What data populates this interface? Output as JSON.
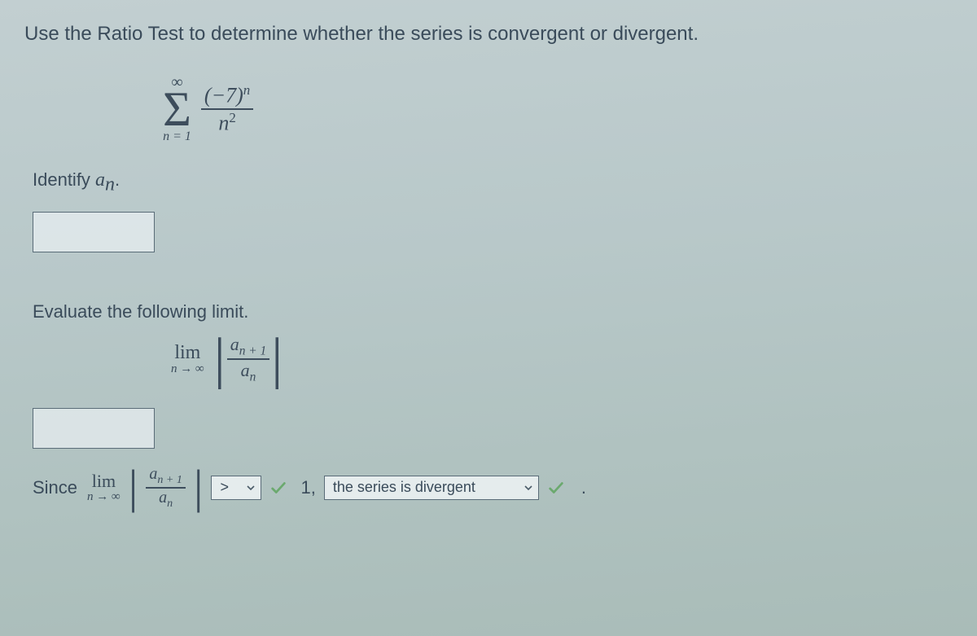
{
  "prompt": "Use the Ratio Test to determine whether the series is convergent or divergent.",
  "series": {
    "upper": "∞",
    "lower": "n = 1",
    "numerator_base": "(−7)",
    "numerator_exp": "n",
    "denominator_base": "n",
    "denominator_exp": "2"
  },
  "identify": {
    "label_pre": "Identify ",
    "var": "a",
    "sub": "n",
    "label_post": "."
  },
  "input1": "",
  "evaluate_label": "Evaluate the following limit.",
  "limit": {
    "lim": "lim",
    "below": "n → ∞",
    "num_base": "a",
    "num_sub": "n + 1",
    "den_base": "a",
    "den_sub": "n"
  },
  "input2": "",
  "conclusion": {
    "since": "Since",
    "lim": "lim",
    "below": "n → ∞",
    "num_base": "a",
    "num_sub": "n + 1",
    "den_base": "a",
    "den_sub": "n",
    "op_selected": ">",
    "one": "1,",
    "result_selected": "the series is divergent",
    "period": "."
  }
}
